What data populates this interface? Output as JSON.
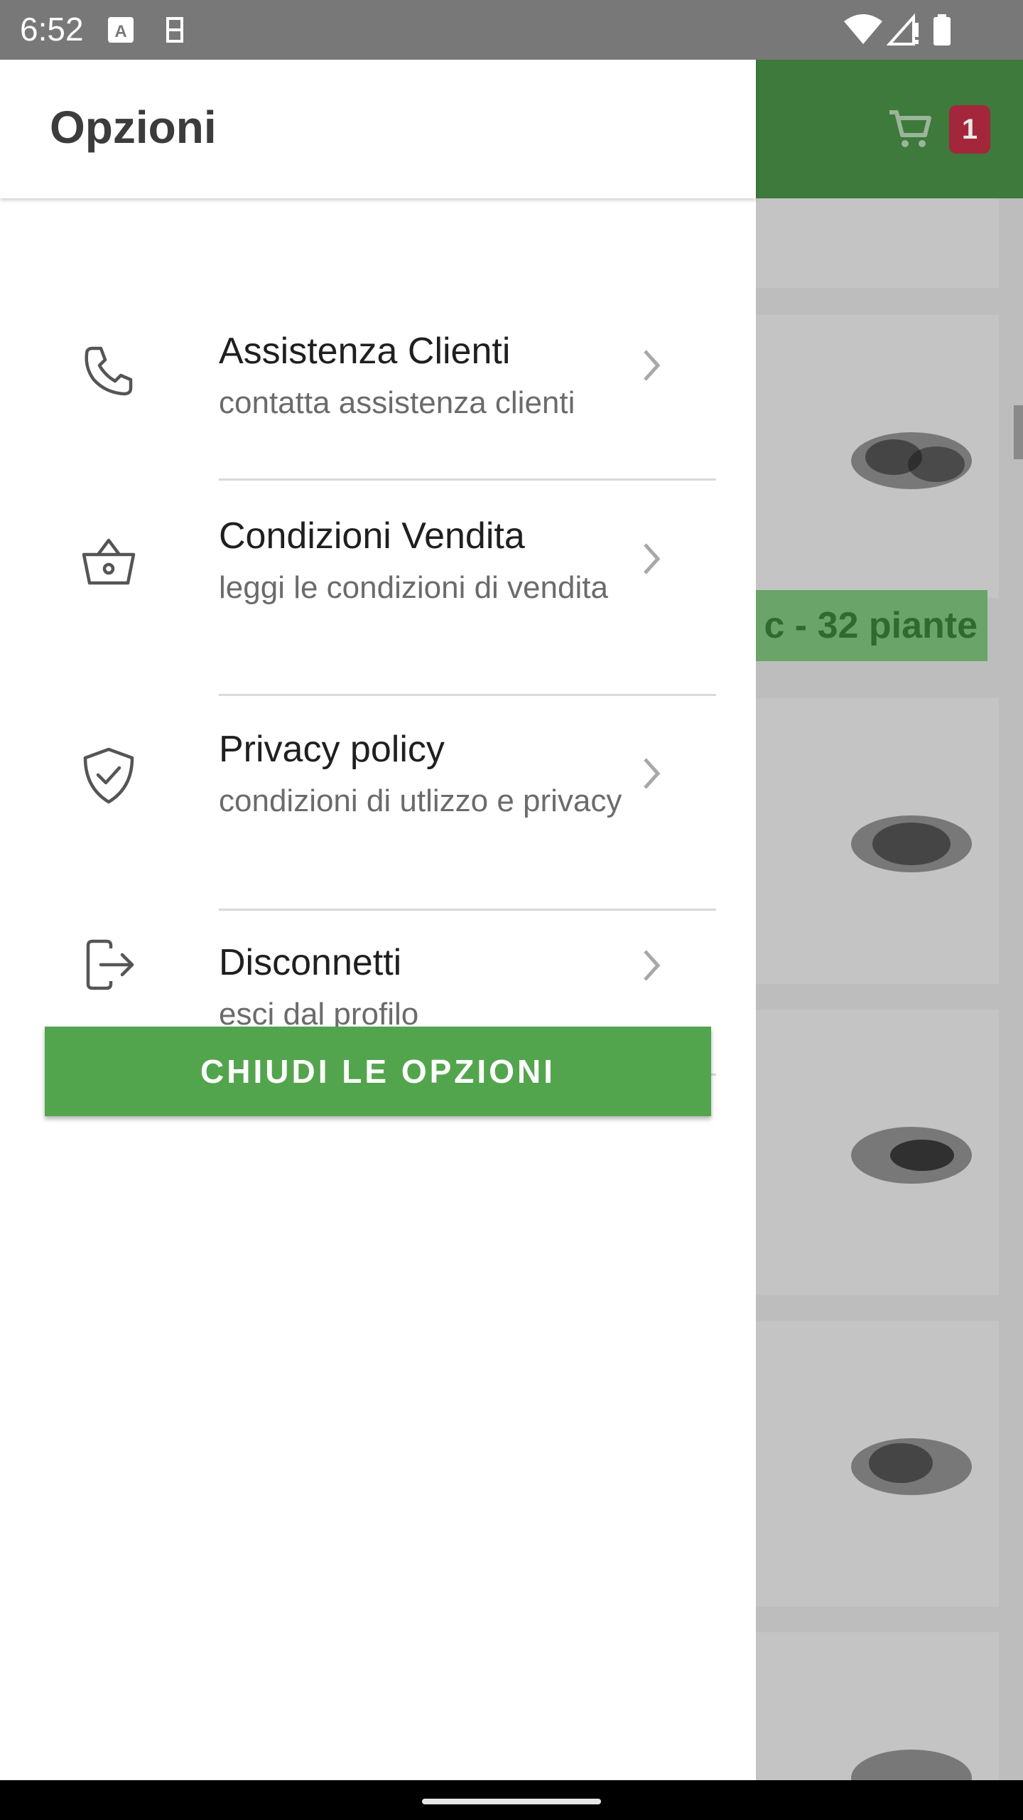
{
  "status_bar": {
    "time": "6:52",
    "icons": [
      "keyboard-a-icon",
      "sim-icon",
      "wifi-icon",
      "signal-icon",
      "battery-icon"
    ]
  },
  "background_app": {
    "cart_icon": "cart-icon",
    "cart_badge_count": "1",
    "promo_label": "c - 32 piante",
    "accent_color": "#3d7a3c"
  },
  "drawer": {
    "title": "Opzioni",
    "items": [
      {
        "title": "Assistenza Clienti",
        "subtitle": "contatta assistenza clienti",
        "icon": "phone-icon"
      },
      {
        "title": "Condizioni Vendita",
        "subtitle": "leggi le condizioni di vendita",
        "icon": "basket-icon"
      },
      {
        "title": "Privacy policy",
        "subtitle": "condizioni di utlizzo e privacy",
        "icon": "shield-check-icon"
      },
      {
        "title": "Disconnetti",
        "subtitle": "esci dal profilo",
        "icon": "logout-icon"
      }
    ],
    "close_button": "CHIUDI LE OPZIONI",
    "button_color": "#53a54d"
  }
}
